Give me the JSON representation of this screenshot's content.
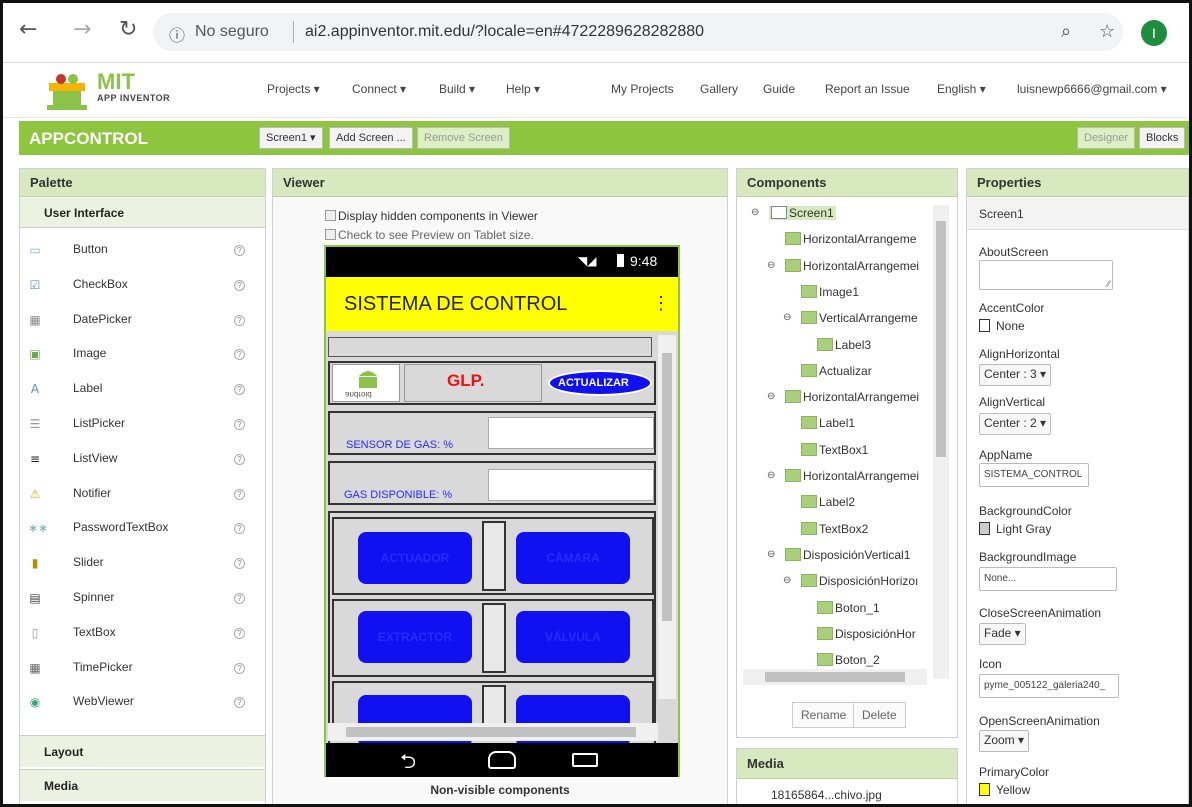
{
  "browser": {
    "security_label": "No seguro",
    "url": "ai2.appinventor.mit.edu/?locale=en#4722289628282880",
    "avatar_letter": "I"
  },
  "header": {
    "logo_mit": "MIT",
    "logo_sub": "APP INVENTOR",
    "menu": [
      "Projects ▾",
      "Connect ▾",
      "Build ▾",
      "Help ▾"
    ],
    "links": [
      "My Projects",
      "Gallery",
      "Guide",
      "Report an Issue",
      "English ▾",
      "luisnewp6666@gmail.com ▾"
    ]
  },
  "toolbar": {
    "project_name": "APPCONTROL",
    "screen_select": "Screen1 ▾",
    "add_screen": "Add Screen ...",
    "remove_screen": "Remove Screen",
    "designer": "Designer",
    "blocks": "Blocks"
  },
  "palette": {
    "title": "Palette",
    "section": "User Interface",
    "items": [
      "Button",
      "CheckBox",
      "DatePicker",
      "Image",
      "Label",
      "ListPicker",
      "ListView",
      "Notifier",
      "PasswordTextBox",
      "Slider",
      "Spinner",
      "TextBox",
      "TimePicker",
      "WebViewer"
    ],
    "help": "?",
    "collapsed": [
      "Layout",
      "Media"
    ]
  },
  "viewer": {
    "title": "Viewer",
    "hidden_components": "Display hidden components in Viewer",
    "tablet_preview": "Check to see Preview on Tablet size.",
    "non_visible": "Non-visible components",
    "phone": {
      "time": "9:48",
      "app_title": "SISTEMA DE CONTROL",
      "menu_dots": "⋮",
      "android_text": "android",
      "glp": "GLP.",
      "actualizar": "ACTUALIZAR",
      "sensor_label": "SENSOR DE GAS: %",
      "gas_label": "GAS DISPONIBLE: %",
      "btn_actuador": "ACTUADOR",
      "btn_camara": "CÁMARA",
      "btn_extractor": "EXTRACTOR",
      "btn_valvula": "VÁLVULA"
    }
  },
  "components": {
    "title": "Components",
    "tree": [
      {
        "label": "Screen1",
        "depth": 0,
        "toggle": "⊖"
      },
      {
        "label": "HorizontalArrangeme",
        "depth": 1,
        "toggle": ""
      },
      {
        "label": "HorizontalArrangemei",
        "depth": 1,
        "toggle": "⊖"
      },
      {
        "label": "Image1",
        "depth": 2,
        "toggle": ""
      },
      {
        "label": "VerticalArrangeme",
        "depth": 2,
        "toggle": "⊖"
      },
      {
        "label": "Label3",
        "depth": 3,
        "toggle": ""
      },
      {
        "label": "Actualizar",
        "depth": 2,
        "toggle": ""
      },
      {
        "label": "HorizontalArrangemei",
        "depth": 1,
        "toggle": "⊖"
      },
      {
        "label": "Label1",
        "depth": 2,
        "toggle": ""
      },
      {
        "label": "TextBox1",
        "depth": 2,
        "toggle": ""
      },
      {
        "label": "HorizontalArrangemei",
        "depth": 1,
        "toggle": "⊖"
      },
      {
        "label": "Label2",
        "depth": 2,
        "toggle": ""
      },
      {
        "label": "TextBox2",
        "depth": 2,
        "toggle": ""
      },
      {
        "label": "DisposiciónVertical1",
        "depth": 1,
        "toggle": "⊖"
      },
      {
        "label": "DisposiciónHorizoı",
        "depth": 2,
        "toggle": "⊖"
      },
      {
        "label": "Boton_1",
        "depth": 3,
        "toggle": ""
      },
      {
        "label": "DisposiciónHor",
        "depth": 3,
        "toggle": ""
      },
      {
        "label": "Boton_2",
        "depth": 3,
        "toggle": ""
      }
    ],
    "rename": "Rename",
    "delete": "Delete"
  },
  "media": {
    "title": "Media",
    "file": "18165864...chivo.jpg"
  },
  "properties": {
    "title": "Properties",
    "screen": "Screen1",
    "about_label": "AboutScreen",
    "accent_label": "AccentColor",
    "accent_value": "None",
    "alignh_label": "AlignHorizontal",
    "alignh_value": "Center : 3 ▾",
    "alignv_label": "AlignVertical",
    "alignv_value": "Center : 2 ▾",
    "appname_label": "AppName",
    "appname_value": "SISTEMA_CONTROL",
    "bgcolor_label": "BackgroundColor",
    "bgcolor_value": "Light Gray",
    "bgimage_label": "BackgroundImage",
    "bgimage_value": "None...",
    "closeanim_label": "CloseScreenAnimation",
    "closeanim_value": "Fade ▾",
    "icon_label": "Icon",
    "icon_value": "pyme_005122_galeria240_",
    "openanim_label": "OpenScreenAnimation",
    "openanim_value": "Zoom ▾",
    "primary_label": "PrimaryColor",
    "primary_value": "Yellow"
  },
  "colors": {
    "green": "#8dc53e",
    "yellow": "#ffff00",
    "blue_button": "#1010f0"
  }
}
